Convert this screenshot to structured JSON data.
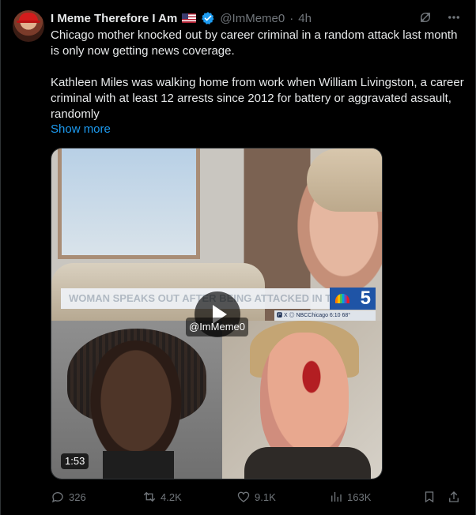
{
  "tweet": {
    "display_name": "I Meme Therefore I Am",
    "handle": "@ImMeme0",
    "separator": "·",
    "time": "4h",
    "text_line1": "Chicago mother knocked out by career criminal in a random attack last month is only now getting news coverage.",
    "text_line2": "Kathleen Miles was walking home from work when William Livingston, a career criminal with at least 12 arrests since 2012 for battery or aggravated assault, randomly",
    "show_more": "Show more"
  },
  "media": {
    "banner_text": "WOMAN SPEAKS OUT AFTER BEING ATTACKED IN THE LOOP",
    "station": "5",
    "lower_bar": "🅿 X ◎ NBCChicago   6:10   68°",
    "watermark": "@ImMeme0",
    "duration": "1:53"
  },
  "actions": {
    "replies": "326",
    "reposts": "4.2K",
    "likes": "9.1K",
    "views": "163K"
  },
  "icons": [
    "avatar",
    "us-flag-icon",
    "verified-badge-icon",
    "grok-icon",
    "more-icon",
    "reply-icon",
    "repost-icon",
    "like-icon",
    "views-icon",
    "bookmark-icon",
    "share-icon"
  ],
  "colors": {
    "background": "#000000",
    "text": "#e7e9ea",
    "secondary": "#71767b",
    "link": "#1d9bf0",
    "verified": "#1d9bf0"
  }
}
